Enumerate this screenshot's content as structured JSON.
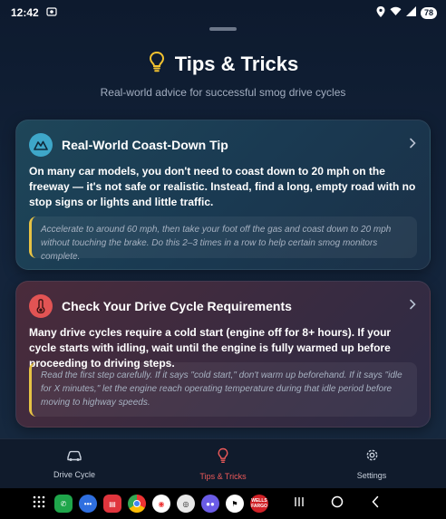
{
  "status": {
    "time": "12:42",
    "battery": "78"
  },
  "header": {
    "title": "Tips & Tricks",
    "subtitle": "Real-world advice for successful smog drive cycles"
  },
  "cards": [
    {
      "title": "Real-World Coast-Down Tip",
      "body": "On many car models, you don't need to coast down to 20 mph on the freeway — it's not safe or realistic. Instead, find a long, empty road with no stop signs or lights and little traffic.",
      "note": "Accelerate to around 60 mph, then take your foot off the gas and coast down to 20 mph without touching the brake. Do this 2–3 times in a row to help certain smog monitors complete.",
      "accent": "#3ea7c9"
    },
    {
      "title": "Check Your Drive Cycle Requirements",
      "body": "Many drive cycles require a cold start (engine off for 8+ hours). If your cycle starts with idling, wait until the engine is fully warmed up before proceeding to driving steps.",
      "note": "Read the first step carefully. If it says \"cold start,\" don't warm up beforehand. If it says \"idle for X minutes,\" let the engine reach operating temperature during that idle period before moving to highway speeds.",
      "accent": "#e25454"
    }
  ],
  "tabs": [
    {
      "label": "Drive Cycle",
      "icon": "car-icon",
      "active": false
    },
    {
      "label": "Tips & Tricks",
      "icon": "lightbulb-icon",
      "active": true
    },
    {
      "label": "Settings",
      "icon": "gear-icon",
      "active": false
    }
  ],
  "colors": {
    "accent_active": "#ee5a5a",
    "note_border": "#e7c244",
    "header_icon": "#f2c230"
  },
  "dock": {
    "wells_fargo": "WELLS FARGO"
  }
}
